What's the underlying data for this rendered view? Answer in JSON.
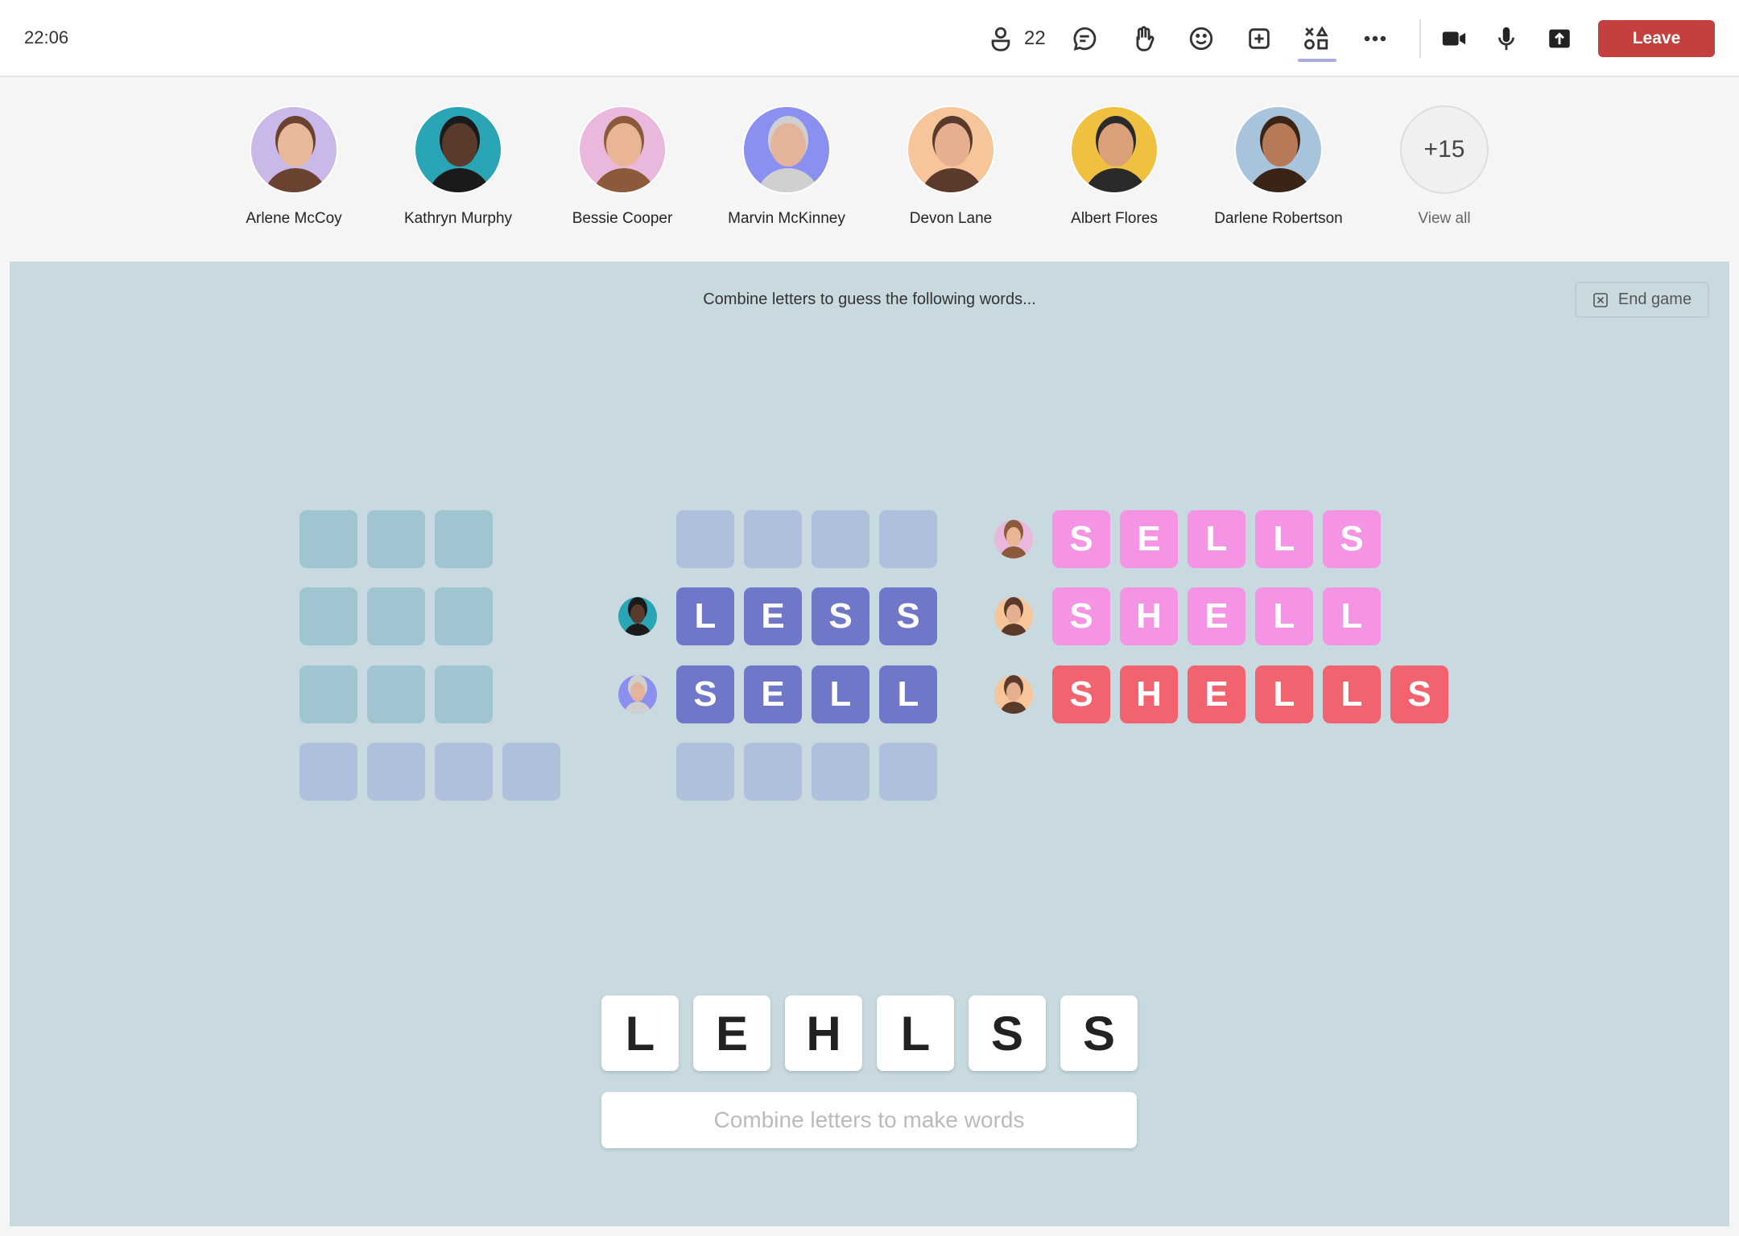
{
  "header": {
    "time": "22:06",
    "participant_count": "22",
    "leave_label": "Leave",
    "icons": [
      "people-icon",
      "chat-icon",
      "raise-hand-icon",
      "reactions-icon",
      "add-app-icon",
      "apps-icon",
      "more-icon",
      "camera-icon",
      "mic-icon",
      "share-icon"
    ]
  },
  "participants": [
    {
      "name": "Arlene McCoy",
      "bg": "#c9b8e8",
      "skin": "#e8b89a",
      "hair": "#6b4230"
    },
    {
      "name": "Kathryn Murphy",
      "bg": "#2aa5b5",
      "skin": "#5a3a2a",
      "hair": "#1a1a1a"
    },
    {
      "name": "Bessie Cooper",
      "bg": "#e9b8dc",
      "skin": "#eab595",
      "hair": "#8a5a3a"
    },
    {
      "name": "Marvin McKinney",
      "bg": "#8a8ff0",
      "skin": "#e3b49a",
      "hair": "#d0d0d0"
    },
    {
      "name": "Devon Lane",
      "bg": "#f7c59a",
      "skin": "#e6b090",
      "hair": "#5a3a2a"
    },
    {
      "name": "Albert Flores",
      "bg": "#f0c040",
      "skin": "#d9a07a",
      "hair": "#2a2a2a"
    },
    {
      "name": "Darlene Robertson",
      "bg": "#a8c4dc",
      "skin": "#b67a58",
      "hair": "#3a2418"
    }
  ],
  "more": {
    "count": "+15",
    "label": "View all"
  },
  "game": {
    "instruction": "Combine letters to guess the following words...",
    "end_game_label": "End game",
    "colors": {
      "empty_teal": "#9fc4d2",
      "empty_lavender": "#b0bfdb",
      "purple": "#7077c9",
      "pink": "#f594e4",
      "red": "#f26370"
    },
    "columns": [
      {
        "rows": [
          {
            "letters": [
              "",
              "",
              ""
            ],
            "color": "empty_teal"
          },
          {
            "letters": [
              "",
              "",
              ""
            ],
            "color": "empty_teal"
          },
          {
            "letters": [
              "",
              "",
              ""
            ],
            "color": "empty_teal"
          },
          {
            "letters": [
              "",
              "",
              "",
              ""
            ],
            "color": "empty_lavender"
          }
        ]
      },
      {
        "rows": [
          {
            "letters": [
              "",
              "",
              "",
              ""
            ],
            "color": "empty_lavender"
          },
          {
            "letters": [
              "L",
              "E",
              "S",
              "S"
            ],
            "color": "purple",
            "guesser": 1
          },
          {
            "letters": [
              "S",
              "E",
              "L",
              "L"
            ],
            "color": "purple",
            "guesser": 3
          },
          {
            "letters": [
              "",
              "",
              "",
              ""
            ],
            "color": "empty_lavender"
          }
        ]
      },
      {
        "rows": [
          {
            "letters": [
              "S",
              "E",
              "L",
              "L",
              "S"
            ],
            "color": "pink",
            "guesser": 2
          },
          {
            "letters": [
              "S",
              "H",
              "E",
              "L",
              "L"
            ],
            "color": "pink",
            "guesser": 4
          },
          {
            "letters": [
              "S",
              "H",
              "E",
              "L",
              "L",
              "S"
            ],
            "color": "red",
            "guesser": 4
          }
        ]
      }
    ],
    "available_letters": [
      "L",
      "E",
      "H",
      "L",
      "S",
      "S"
    ],
    "input_placeholder": "Combine letters to make words",
    "input_value": ""
  }
}
